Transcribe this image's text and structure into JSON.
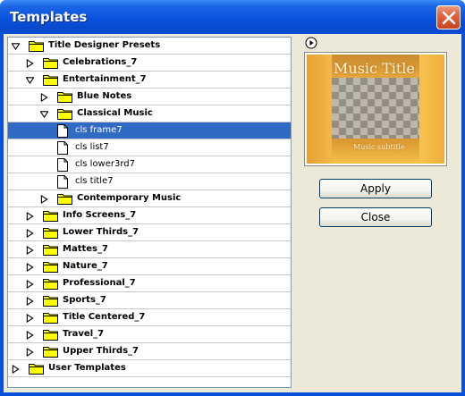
{
  "window": {
    "title": "Templates"
  },
  "tree": {
    "items": [
      {
        "label": "Title Designer Presets",
        "type": "folder",
        "expanded": true,
        "selected": false,
        "bold": true
      },
      {
        "label": "Celebrations_7",
        "type": "folder",
        "expanded": false,
        "selected": false,
        "bold": true
      },
      {
        "label": "Entertainment_7",
        "type": "folder",
        "expanded": true,
        "selected": false,
        "bold": true
      },
      {
        "label": "Blue Notes",
        "type": "folder",
        "expanded": false,
        "selected": false,
        "bold": true
      },
      {
        "label": "Classical Music",
        "type": "folder",
        "expanded": true,
        "selected": false,
        "bold": true
      },
      {
        "label": "cls frame7",
        "type": "file",
        "selected": true,
        "bold": false
      },
      {
        "label": "cls list7",
        "type": "file",
        "selected": false,
        "bold": false
      },
      {
        "label": "cls lower3rd7",
        "type": "file",
        "selected": false,
        "bold": false
      },
      {
        "label": "cls title7",
        "type": "file",
        "selected": false,
        "bold": false
      },
      {
        "label": "Contemporary Music",
        "type": "folder",
        "expanded": false,
        "selected": false,
        "bold": true
      },
      {
        "label": "Info Screens_7",
        "type": "folder",
        "expanded": false,
        "selected": false,
        "bold": true
      },
      {
        "label": "Lower Thirds_7",
        "type": "folder",
        "expanded": false,
        "selected": false,
        "bold": true
      },
      {
        "label": "Mattes_7",
        "type": "folder",
        "expanded": false,
        "selected": false,
        "bold": true
      },
      {
        "label": "Nature_7",
        "type": "folder",
        "expanded": false,
        "selected": false,
        "bold": true
      },
      {
        "label": "Professional_7",
        "type": "folder",
        "expanded": false,
        "selected": false,
        "bold": true
      },
      {
        "label": "Sports_7",
        "type": "folder",
        "expanded": false,
        "selected": false,
        "bold": true
      },
      {
        "label": "Title Centered_7",
        "type": "folder",
        "expanded": false,
        "selected": false,
        "bold": true
      },
      {
        "label": "Travel_7",
        "type": "folder",
        "expanded": false,
        "selected": false,
        "bold": true
      },
      {
        "label": "Upper Thirds_7",
        "type": "folder",
        "expanded": false,
        "selected": false,
        "bold": true
      },
      {
        "label": "User Templates",
        "type": "folder",
        "expanded": false,
        "selected": false,
        "bold": true
      }
    ]
  },
  "preview": {
    "title_text": "Music Title",
    "subtitle_text": "Music subtitle",
    "play_icon": "play-icon"
  },
  "buttons": {
    "apply_label": "Apply",
    "close_label": "Close"
  },
  "colors": {
    "titlebar": "#0a52dc",
    "selection": "#316ac5",
    "dialog_bg": "#ece9d8",
    "folder": "#ffff00"
  }
}
